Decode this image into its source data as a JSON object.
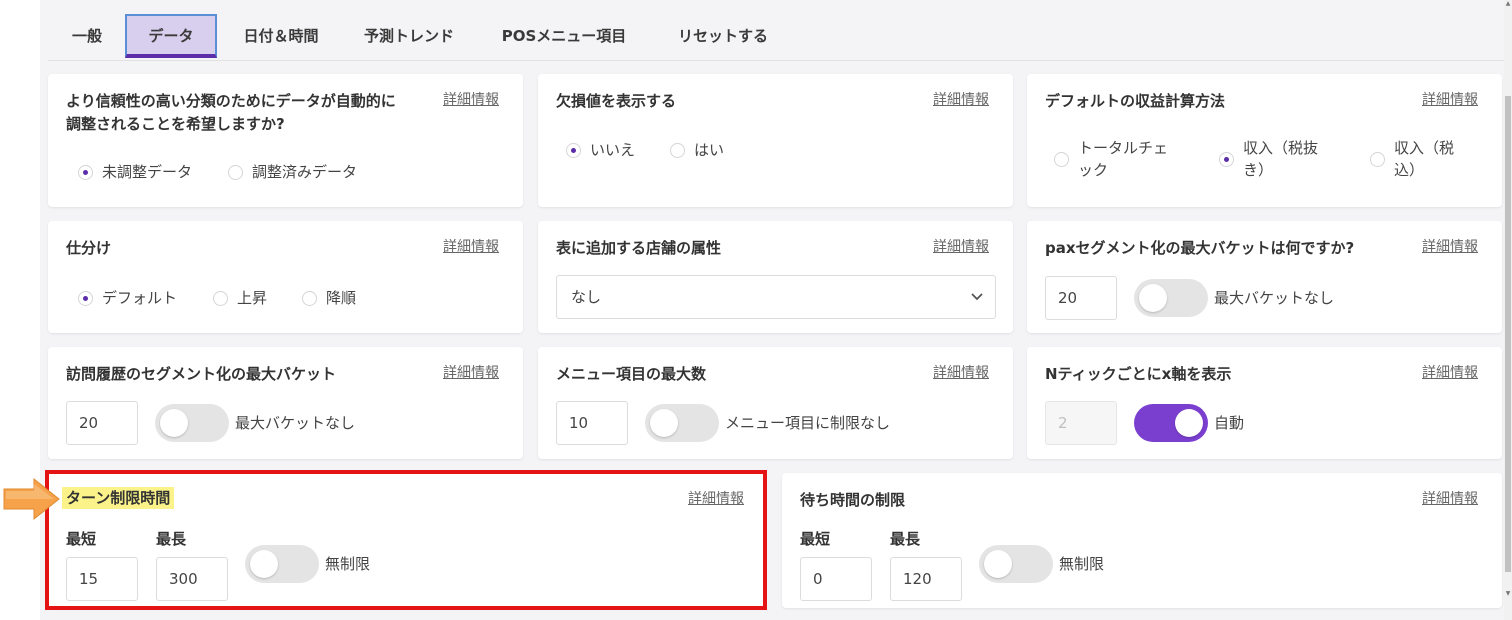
{
  "tabs": [
    "一般",
    "データ",
    "日付＆時間",
    "予測トレンド",
    "POSメニュー項目",
    "リセットする"
  ],
  "active_tab_index": 1,
  "details_label": "詳細情報",
  "cards": {
    "auto_adjust": {
      "title_line1": "より信頼性の高い分類のためにデータが自動的に",
      "title_line2": "調整されることを希望しますか?",
      "options": [
        "未調整データ",
        "調整済みデータ"
      ],
      "selected_index": 0
    },
    "missing_values": {
      "title": "欠損値を表示する",
      "options": [
        "いいえ",
        "はい"
      ],
      "selected_index": 0
    },
    "revenue_method": {
      "title": "デフォルトの収益計算方法",
      "options": [
        {
          "line1": "トータルチェ",
          "line2": "ック"
        },
        {
          "line1": "収入（税抜",
          "line2": "き）"
        },
        {
          "line1": "収入（税",
          "line2": "込）"
        }
      ],
      "selected_index": 1
    },
    "sort": {
      "title": "仕分け",
      "options": [
        "デフォルト",
        "上昇",
        "降順"
      ],
      "selected_index": 0
    },
    "store_attr": {
      "title": "表に追加する店舗の属性",
      "selected_value": "なし"
    },
    "pax_bucket": {
      "title": "paxセグメント化の最大バケットは何ですか?",
      "value": "20",
      "toggle_label": "最大バケットなし",
      "toggle_on": false
    },
    "visit_bucket": {
      "title": "訪問履歴のセグメント化の最大バケット",
      "value": "20",
      "toggle_label": "最大バケットなし",
      "toggle_on": false
    },
    "menu_max": {
      "title": "メニュー項目の最大数",
      "value": "10",
      "toggle_label": "メニュー項目に制限なし",
      "toggle_on": false
    },
    "x_axis": {
      "title": "Nティックごとにx軸を表示",
      "value": "2",
      "toggle_label": "自動",
      "toggle_on": true
    },
    "turn_limit": {
      "title": "ターン制限時間",
      "min_label": "最短",
      "max_label": "最長",
      "min_value": "15",
      "max_value": "300",
      "toggle_label": "無制限",
      "toggle_on": false
    },
    "wait_limit": {
      "title": "待ち時間の制限",
      "min_label": "最短",
      "max_label": "最長",
      "min_value": "0",
      "max_value": "120",
      "toggle_label": "無制限",
      "toggle_on": false
    }
  },
  "icons": {
    "chevron": "chevron-down-icon",
    "pointer": "arrow-right-icon"
  },
  "colors": {
    "accent": "#5b2da8",
    "toggle_on": "#7b3fd0",
    "active_tab_bg": "#d8cfee",
    "annotation_red": "#e41414",
    "annotation_highlight": "#fbf38a",
    "annotation_arrow": "#f5a24a"
  }
}
